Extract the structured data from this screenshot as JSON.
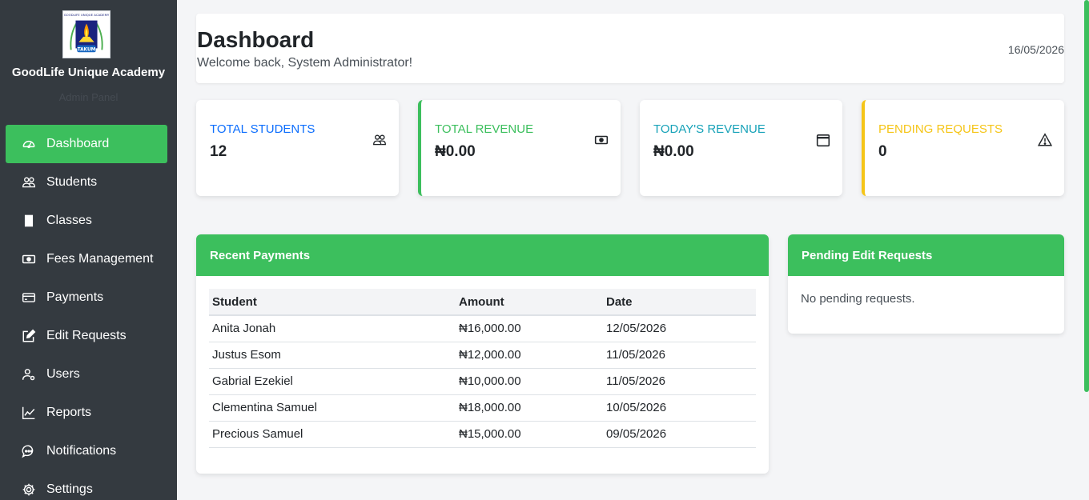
{
  "sidebar": {
    "brand": "GoodLife Unique Academy",
    "subtitle": "Admin Panel",
    "logo": {
      "top_text": "GOODLIFE UNIQUE ACADEMY",
      "badge": "TAKUM"
    },
    "items": [
      {
        "label": "Dashboard",
        "icon": "gauge-icon",
        "active": true
      },
      {
        "label": "Students",
        "icon": "people-icon"
      },
      {
        "label": "Classes",
        "icon": "book-icon"
      },
      {
        "label": "Fees Management",
        "icon": "cash-icon"
      },
      {
        "label": "Payments",
        "icon": "credit-card-icon"
      },
      {
        "label": "Edit Requests",
        "icon": "pencil-square-icon"
      },
      {
        "label": "Users",
        "icon": "user-gear-icon"
      },
      {
        "label": "Reports",
        "icon": "chart-line-icon"
      },
      {
        "label": "Notifications",
        "icon": "chat-dots-icon"
      },
      {
        "label": "Settings",
        "icon": "gear-icon"
      }
    ]
  },
  "header": {
    "title": "Dashboard",
    "welcome": "Welcome back, System Administrator!",
    "date": "16/05/2026"
  },
  "stats": [
    {
      "label": "TOTAL STUDENTS",
      "value": "12",
      "icon": "people-icon",
      "color": "#0d6efd"
    },
    {
      "label": "TOTAL REVENUE",
      "value": "₦0.00",
      "icon": "cash-icon",
      "color": "#3cbf5d"
    },
    {
      "label": "TODAY'S REVENUE",
      "value": "₦0.00",
      "icon": "calendar-icon",
      "color": "#17a2b8"
    },
    {
      "label": "PENDING REQUESTS",
      "value": "0",
      "icon": "warning-icon",
      "color": "#f5c518"
    }
  ],
  "recent_payments": {
    "title": "Recent Payments",
    "columns": [
      "Student",
      "Amount",
      "Date"
    ],
    "rows": [
      [
        "Anita Jonah",
        "₦16,000.00",
        "12/05/2026"
      ],
      [
        "Justus Esom",
        "₦12,000.00",
        "11/05/2026"
      ],
      [
        "Gabrial Ezekiel",
        "₦10,000.00",
        "11/05/2026"
      ],
      [
        "Clementina Samuel",
        "₦18,000.00",
        "10/05/2026"
      ],
      [
        "Precious Samuel",
        "₦15,000.00",
        "09/05/2026"
      ]
    ]
  },
  "pending_edit": {
    "title": "Pending Edit Requests",
    "empty_text": "No pending requests."
  },
  "colors": {
    "accent": "#3cbf5d",
    "sidebar_bg": "#343a40"
  }
}
